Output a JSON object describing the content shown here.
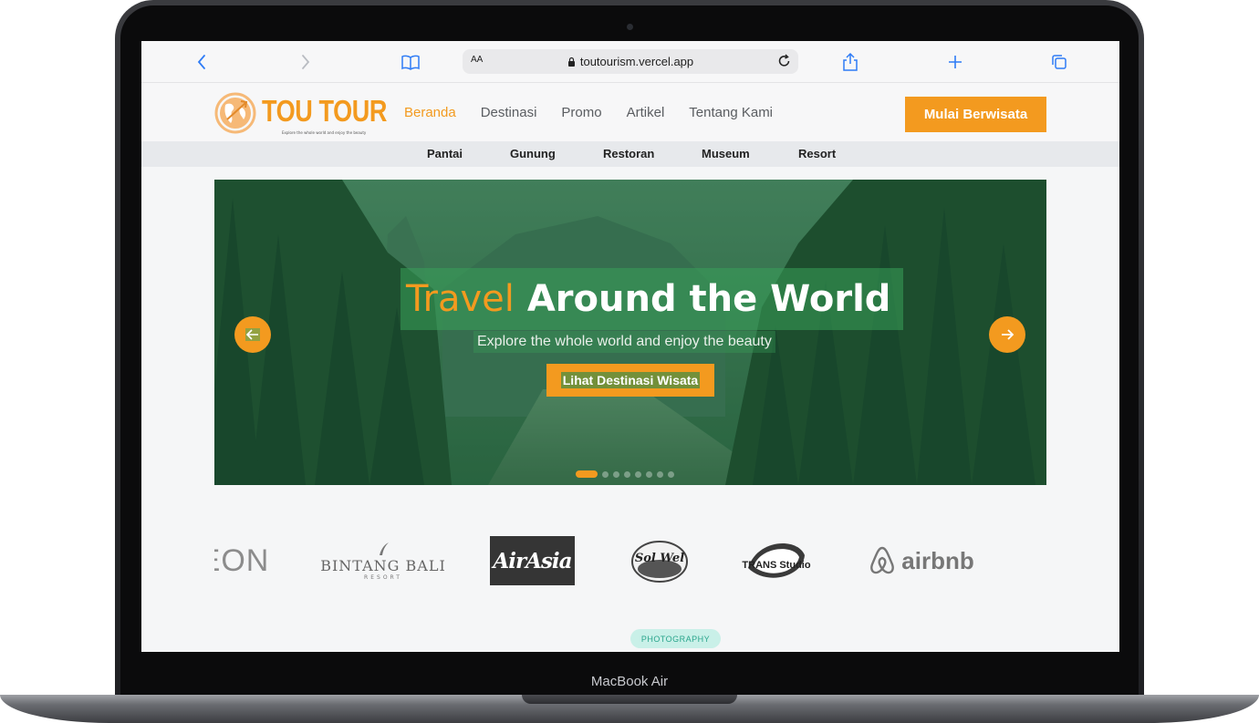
{
  "device": {
    "label": "MacBook Air"
  },
  "browser": {
    "aa_label": "AA",
    "url": "toutourism.vercel.app"
  },
  "site": {
    "logo_text": "TOU TOUR",
    "logo_tagline": "Explore the whole world and enjoy the beauty",
    "nav": [
      "Beranda",
      "Destinasi",
      "Promo",
      "Artikel",
      "Tentang Kami"
    ],
    "active_nav": "Beranda",
    "cta_label": "Mulai Berwisata",
    "categories": [
      "Pantai",
      "Gunung",
      "Restoran",
      "Museum",
      "Resort"
    ]
  },
  "hero": {
    "title_accent": "Travel",
    "title_rest": "Around the World",
    "subtitle": "Explore the whole world and enjoy the beauty",
    "button_label": "Lihat Destinasi Wisata",
    "slide_count": 8,
    "active_slide": 1
  },
  "partners": {
    "eon": "EON",
    "bintang_bali": "BINTANG BALI",
    "bintang_bali_sub": "RESORT",
    "airasia": "AirAsia",
    "goodwill": "Sol Wel",
    "trans_studio": "TRANS Studio",
    "airbnb": "airbnb"
  },
  "section_badge": "PHOTOGRAPHY",
  "colors": {
    "accent": "#f39a1f",
    "hero_green": "#1d4a2c",
    "badge_bg": "#c9f0e8",
    "badge_text": "#2aa58c"
  }
}
